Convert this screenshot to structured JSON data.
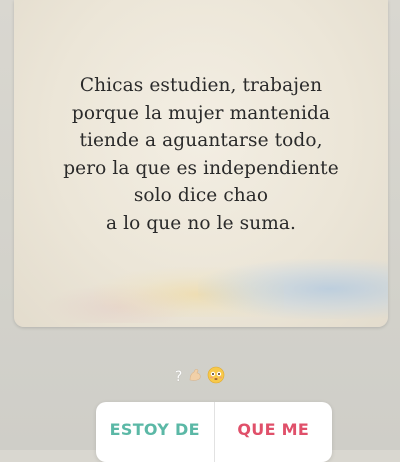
{
  "story": {
    "quote_lines": [
      "Chicas estudien, trabajen",
      "porque la mujer mantenida",
      "tiende a aguantarse todo,",
      "pero la que es independiente",
      "solo dice chao",
      "a lo que no le suma."
    ]
  },
  "reaction": {
    "text": "?",
    "icons": [
      "flexed-biceps-icon",
      "flushed-face-icon"
    ]
  },
  "poll": {
    "options": [
      {
        "label": "ESTOY DE",
        "color": "#5bb8a6"
      },
      {
        "label": "QUE ME",
        "color": "#e0506a"
      }
    ]
  }
}
